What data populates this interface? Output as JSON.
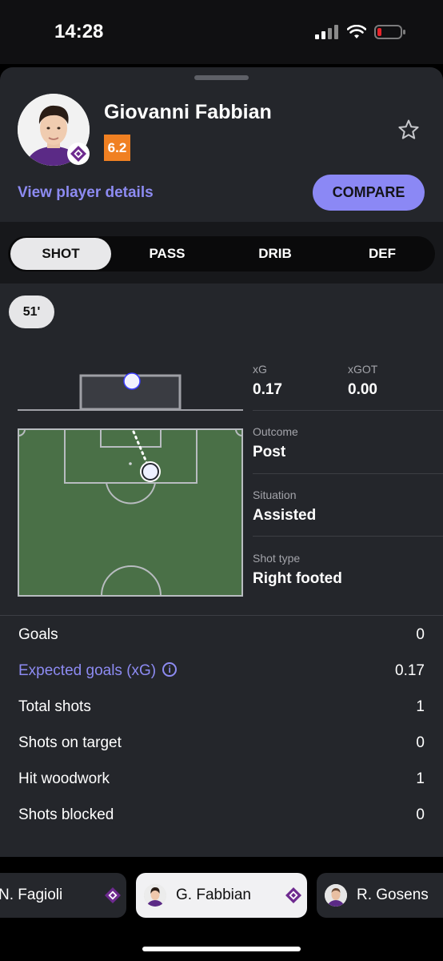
{
  "status": {
    "time": "14:28"
  },
  "player": {
    "name": "Giovanni Fabbian",
    "rating": "6.2",
    "view_details": "View player details",
    "compare": "COMPARE"
  },
  "tabs": [
    "SHOT",
    "PASS",
    "DRIB",
    "DEF"
  ],
  "shot": {
    "minute": "51'",
    "xg_label": "xG",
    "xg_value": "0.17",
    "xgot_label": "xGOT",
    "xgot_value": "0.00",
    "outcome_label": "Outcome",
    "outcome_value": "Post",
    "situation_label": "Situation",
    "situation_value": "Assisted",
    "shot_type_label": "Shot type",
    "shot_type_value": "Right footed"
  },
  "summary": [
    {
      "label": "Goals",
      "value": "0"
    },
    {
      "label": "Expected goals (xG)",
      "value": "0.17"
    },
    {
      "label": "Total shots",
      "value": "1"
    },
    {
      "label": "Shots on target",
      "value": "0"
    },
    {
      "label": "Hit woodwork",
      "value": "1"
    },
    {
      "label": "Shots blocked",
      "value": "0"
    }
  ],
  "player_carousel": [
    "N. Fagioli",
    "G. Fabbian",
    "R. Gosens"
  ],
  "colors": {
    "accent": "#8b88f5",
    "rating": "#f08022",
    "pitch": "#4a7047",
    "sheet": "#24262b",
    "team": "#6e2a8f"
  }
}
